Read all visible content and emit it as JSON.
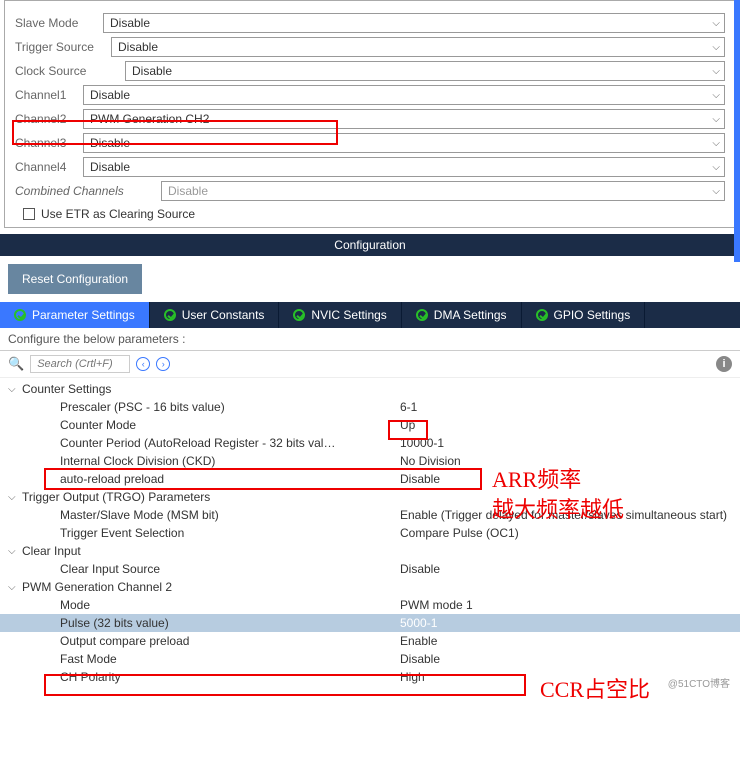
{
  "top": {
    "rows": [
      {
        "label": "Slave Mode",
        "value": "Disable",
        "labelW": 82,
        "name": "slave-mode"
      },
      {
        "label": "Trigger Source",
        "value": "Disable",
        "labelW": 90,
        "name": "trigger-source"
      },
      {
        "label": "Clock Source",
        "value": "Disable",
        "labelW": 104,
        "name": "clock-source"
      },
      {
        "label": "Channel1",
        "value": "Disable",
        "labelW": 62,
        "name": "channel1"
      },
      {
        "label": "Channel2",
        "value": "PWM Generation CH2",
        "labelW": 62,
        "name": "channel2"
      },
      {
        "label": "Channel3",
        "value": "Disable",
        "labelW": 62,
        "name": "channel3"
      },
      {
        "label": "Channel4",
        "value": "Disable",
        "labelW": 62,
        "name": "channel4"
      }
    ],
    "combined_label": "Combined Channels",
    "combined_value": "Disable",
    "checkbox_label": "Use ETR as Clearing Source"
  },
  "config_bar": "Configuration",
  "reset_btn": "Reset Configuration",
  "tabs": [
    {
      "label": "Parameter Settings",
      "name": "tab-parameter-settings",
      "active": true
    },
    {
      "label": "User Constants",
      "name": "tab-user-constants",
      "active": false
    },
    {
      "label": "NVIC Settings",
      "name": "tab-nvic-settings",
      "active": false
    },
    {
      "label": "DMA Settings",
      "name": "tab-dma-settings",
      "active": false
    },
    {
      "label": "GPIO Settings",
      "name": "tab-gpio-settings",
      "active": false
    }
  ],
  "cfg_header": "Configure the below parameters :",
  "search_placeholder": "Search (Crtl+F)",
  "groups": {
    "counter": {
      "title": "Counter Settings",
      "rows": [
        {
          "name": "Prescaler (PSC - 16 bits value)",
          "value": "6-1"
        },
        {
          "name": "Counter Mode",
          "value": "Up"
        },
        {
          "name": "Counter Period (AutoReload Register - 32 bits val…",
          "value": "10000-1"
        },
        {
          "name": "Internal Clock Division (CKD)",
          "value": "No Division"
        },
        {
          "name": "auto-reload preload",
          "value": "Disable"
        }
      ]
    },
    "trgo": {
      "title": "Trigger Output (TRGO) Parameters",
      "rows": [
        {
          "name": "Master/Slave Mode (MSM bit)",
          "value": "Enable (Trigger delayed for master/slaves simultaneous start)"
        },
        {
          "name": "Trigger Event Selection",
          "value": "Compare Pulse (OC1)"
        }
      ]
    },
    "clear": {
      "title": "Clear Input",
      "rows": [
        {
          "name": "Clear Input Source",
          "value": "Disable"
        }
      ]
    },
    "pwm2": {
      "title": "PWM Generation Channel 2",
      "rows": [
        {
          "name": "Mode",
          "value": "PWM mode 1",
          "hl": false
        },
        {
          "name": "Pulse (32 bits value)",
          "value": "5000-1",
          "hl": true
        },
        {
          "name": "Output compare preload",
          "value": "Enable",
          "hl": false
        },
        {
          "name": "Fast Mode",
          "value": "Disable",
          "hl": false
        },
        {
          "name": "CH Polarity",
          "value": "High",
          "hl": false
        }
      ]
    }
  },
  "annotations": {
    "arr1": "ARR频率",
    "arr2": "越大频率越低",
    "ccr": "CCR占空比"
  },
  "watermark": "@51CTO博客"
}
